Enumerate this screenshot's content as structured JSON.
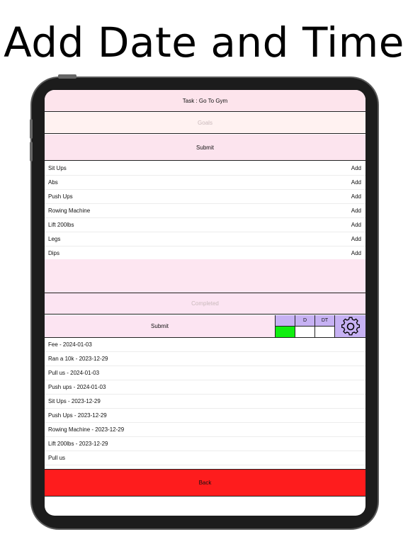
{
  "headline": "Add Date and Time",
  "task_label": "Task : Go To Gym",
  "goals_placeholder": "Goals",
  "submit_label": "Submit",
  "goals": [
    {
      "name": "Sit Ups",
      "action": "Add"
    },
    {
      "name": "Abs",
      "action": "Add"
    },
    {
      "name": "Push Ups",
      "action": "Add"
    },
    {
      "name": "Rowing Machine",
      "action": "Add"
    },
    {
      "name": "Lift 200lbs",
      "action": "Add"
    },
    {
      "name": "Legs",
      "action": "Add"
    },
    {
      "name": "Dips",
      "action": "Add"
    }
  ],
  "completed_placeholder": "Completed",
  "completed_submit_label": "Submit",
  "toggles": {
    "d_label": "D",
    "dt_label": "DT"
  },
  "completed_items": [
    "Fee - 2024-01-03",
    "Ran a 10k - 2023-12-29",
    "Pull us - 2024-01-03",
    "Push ups - 2024-01-03",
    "Sit Ups - 2023-12-29",
    "Push Ups - 2023-12-29",
    "Rowing Machine - 2023-12-29",
    "Lift 200lbs - 2023-12-29",
    "Pull us"
  ],
  "back_label": "Back",
  "colors": {
    "accent_purple": "#c6b1f3",
    "toggle_on": "#10ee10",
    "back_red": "#fe1c1d",
    "pink": "#fde4ec"
  }
}
